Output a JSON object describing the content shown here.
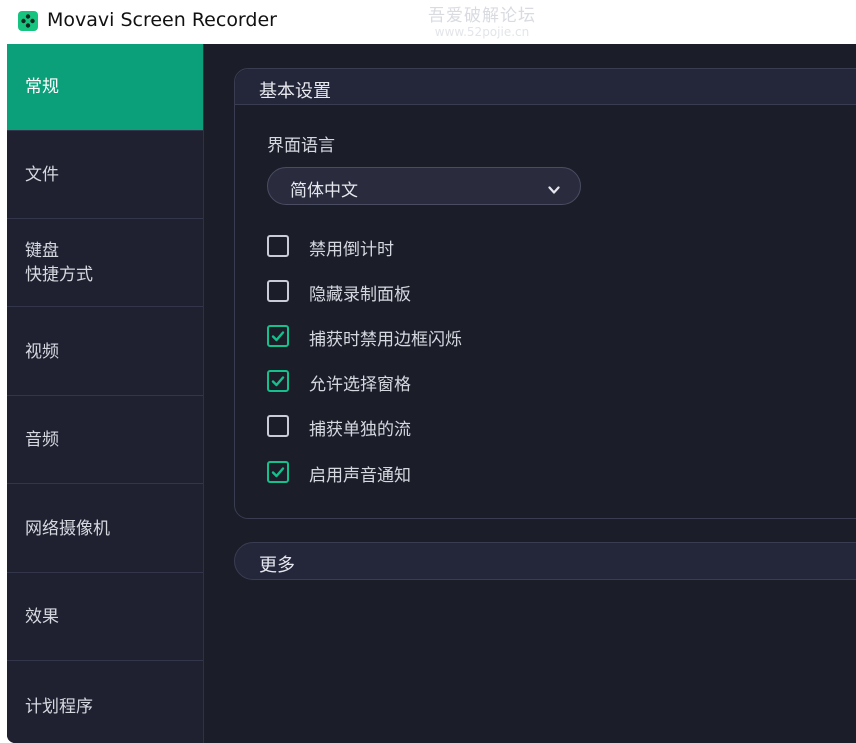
{
  "window": {
    "title": "Movavi Screen Recorder",
    "watermark_line1": "吾爱破解论坛",
    "watermark_line2": "www.52pojie.cn"
  },
  "sidebar": {
    "items": [
      {
        "label": "常规",
        "active": true
      },
      {
        "label": "文件",
        "active": false
      },
      {
        "label": "键盘\n快捷方式",
        "active": false
      },
      {
        "label": "视频",
        "active": false
      },
      {
        "label": "音频",
        "active": false
      },
      {
        "label": "网络摄像机",
        "active": false
      },
      {
        "label": "效果",
        "active": false
      },
      {
        "label": "计划程序",
        "active": false
      }
    ]
  },
  "basic": {
    "title": "基本设置",
    "language_label": "界面语言",
    "language_value": "简体中文",
    "options": [
      {
        "label": "禁用倒计时",
        "checked": false
      },
      {
        "label": "隐藏录制面板",
        "checked": false
      },
      {
        "label": "捕获时禁用边框闪烁",
        "checked": true
      },
      {
        "label": "允许选择窗格",
        "checked": true
      },
      {
        "label": "捕获单独的流",
        "checked": false
      },
      {
        "label": "启用声音通知",
        "checked": true
      }
    ]
  },
  "more": {
    "title": "更多"
  },
  "colors": {
    "accent": "#0ba07a",
    "check": "#15c08c",
    "background": "#1b1d29",
    "sidebar": "#1f2130"
  },
  "icons": {
    "app": "movavi-app-icon",
    "dropdown": "chevron-down-icon",
    "checkmark": "checkmark-icon"
  }
}
